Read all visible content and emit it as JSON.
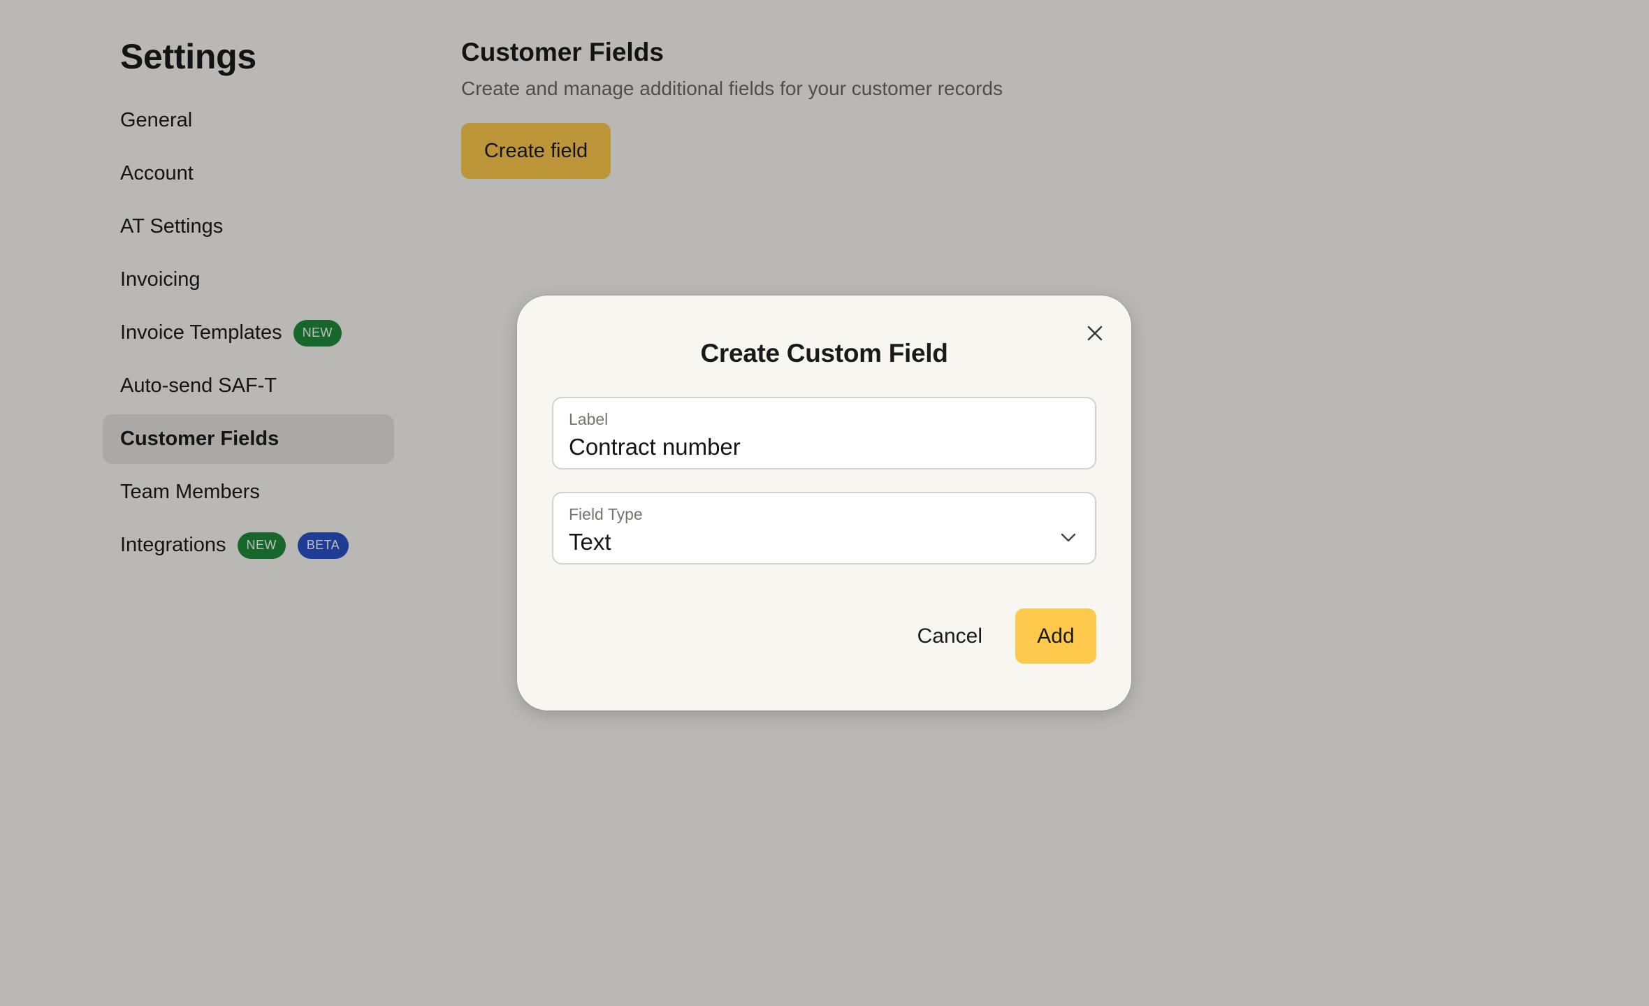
{
  "sidebar": {
    "title": "Settings",
    "items": [
      {
        "label": "General",
        "badges": []
      },
      {
        "label": "Account",
        "badges": []
      },
      {
        "label": "AT Settings",
        "badges": []
      },
      {
        "label": "Invoicing",
        "badges": []
      },
      {
        "label": "Invoice Templates",
        "badges": [
          "NEW"
        ]
      },
      {
        "label": "Auto-send SAF-T",
        "badges": []
      },
      {
        "label": "Customer Fields",
        "badges": [],
        "active": true
      },
      {
        "label": "Team Members",
        "badges": []
      },
      {
        "label": "Integrations",
        "badges": [
          "NEW",
          "BETA"
        ]
      }
    ]
  },
  "main": {
    "title": "Customer Fields",
    "subtitle": "Create and manage additional fields for your customer records",
    "create_button": "Create field"
  },
  "modal": {
    "title": "Create Custom Field",
    "label_field": {
      "label": "Label",
      "value": "Contract number"
    },
    "type_field": {
      "label": "Field Type",
      "value": "Text"
    },
    "cancel_label": "Cancel",
    "add_label": "Add"
  },
  "colors": {
    "accent": "#ffc94d",
    "badge_new": "#1f8a3a",
    "badge_beta": "#2b52c9"
  },
  "icons": {
    "close": "close-icon",
    "dropdown": "chevron-down-icon"
  }
}
